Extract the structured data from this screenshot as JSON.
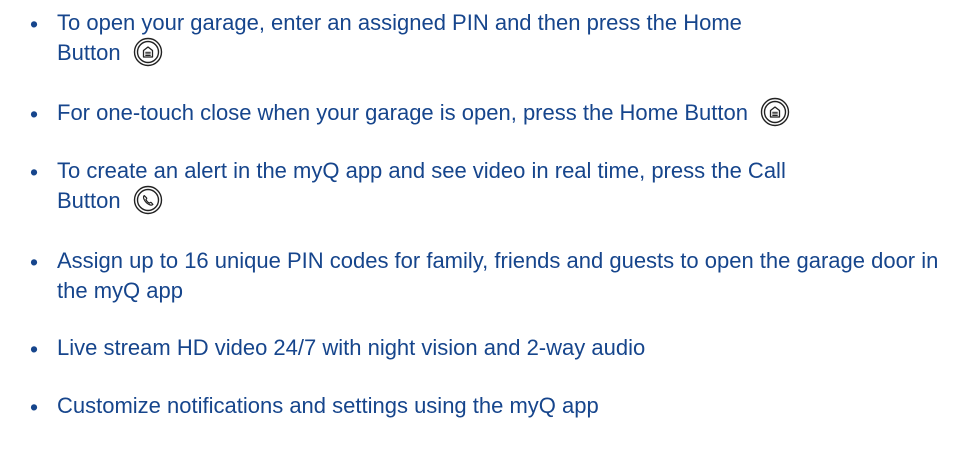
{
  "bullets": [
    {
      "text_before": "To open your garage, enter an assigned PIN and then press the Home",
      "text_after": "Button",
      "icon": "home-button-icon"
    },
    {
      "text_before": "For one-touch close when your garage is open, press the Home Button",
      "icon": "home-button-icon"
    },
    {
      "text_before": "To create an alert in the myQ app and see video in real time, press the Call",
      "text_after": "Button",
      "icon": "call-button-icon"
    },
    {
      "text": "Assign up to 16 unique PIN codes for family, friends and guests to open the garage door in the myQ app"
    },
    {
      "text": "Live stream HD video 24/7 with night vision and 2-way audio"
    },
    {
      "text": "Customize notifications and settings using the myQ app"
    }
  ],
  "bullet_symbol": "•",
  "colors": {
    "text": "#16458c",
    "icon_stroke": "#222222"
  }
}
